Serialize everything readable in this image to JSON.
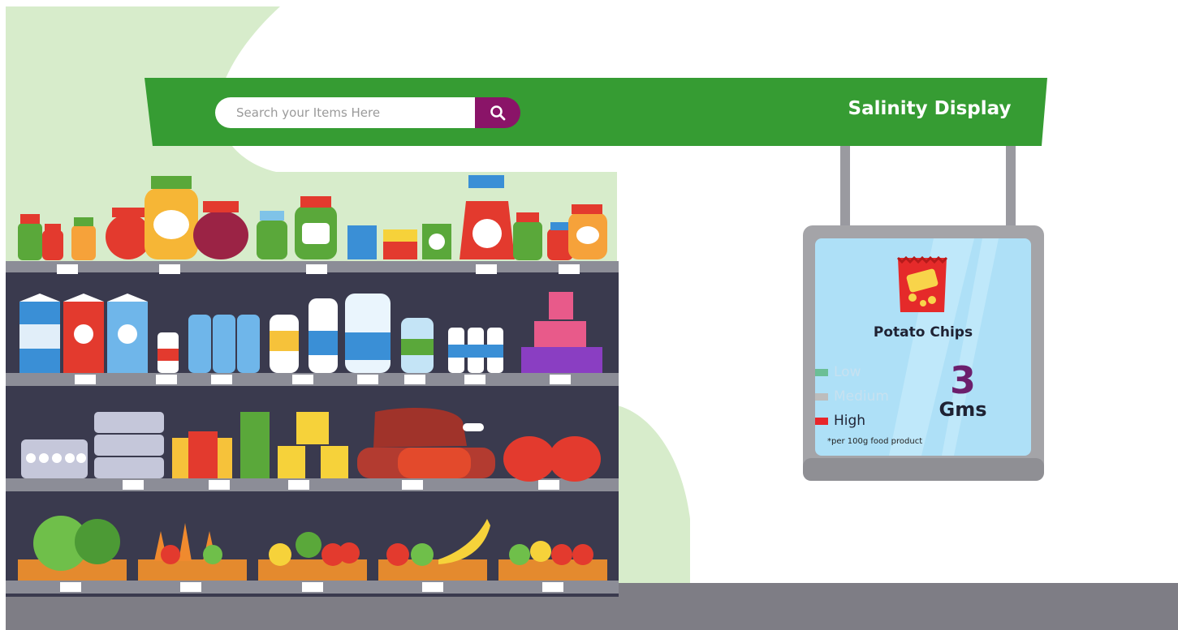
{
  "search": {
    "placeholder": "Search your Items Here"
  },
  "banner": {
    "title": "Salinity Display"
  },
  "display": {
    "product_name": "Potato Chips",
    "legend": [
      {
        "label": "Low",
        "color": "#6bbf96"
      },
      {
        "label": "Medium",
        "color": "#bdbdbd"
      },
      {
        "label": "High",
        "color": "#e8262b"
      }
    ],
    "active_level": "High",
    "value": "3",
    "unit": "Gms",
    "note": "*per 100g food product"
  },
  "colors": {
    "banner_green": "#369c33",
    "search_button": "#8a1468",
    "floor": "#7e7d85",
    "shelf_dark": "#3a3a4e",
    "screen_blue": "#aee0f7"
  }
}
